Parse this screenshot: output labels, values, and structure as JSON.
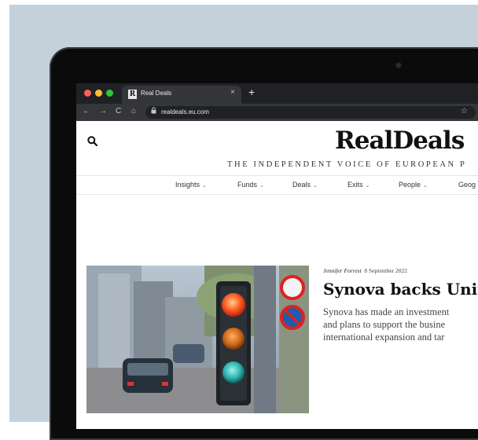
{
  "browser": {
    "tab_title": "Real Deals",
    "tab_close": "×",
    "new_tab": "+",
    "favicon_letter": "R",
    "url": "realdeals.eu.com",
    "nav": {
      "back": "←",
      "forward": "→",
      "reload": "C",
      "home": "⌂",
      "bookmark": "☆"
    }
  },
  "site": {
    "logo": "RealDeals",
    "tagline": "THE INDEPENDENT VOICE OF EUROPEAN P",
    "menu": [
      {
        "label": "Insights"
      },
      {
        "label": "Funds"
      },
      {
        "label": "Deals"
      },
      {
        "label": "Exits"
      },
      {
        "label": "People"
      },
      {
        "label": "Geog"
      }
    ],
    "menu_chevron": "⌄"
  },
  "article": {
    "author": "Jennifer Forrest",
    "date": "8 September 2022",
    "headline": "Synova backs Unit",
    "excerpt_lines": [
      "Synova has made an investment",
      "and plans to support the busine",
      "international expansion and tar"
    ]
  },
  "colors": {
    "background_panel": "#c5d1da",
    "accent_red": "#d23c3c",
    "browser_dark": "#202124"
  }
}
